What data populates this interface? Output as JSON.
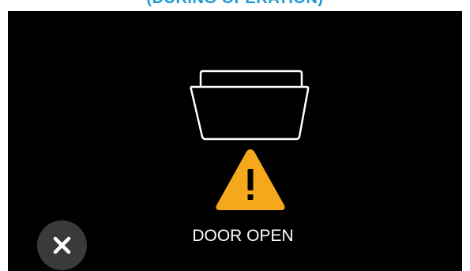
{
  "header": {
    "caption": "(DURING OPERATION)"
  },
  "alert": {
    "message": "DOOR OPEN",
    "icons": {
      "door": "door-open-icon",
      "warning": "warning-triangle-icon",
      "close": "close-icon"
    }
  },
  "colors": {
    "caption": "#1a9bd7",
    "background": "#000000",
    "warning": "#f5a81c",
    "close_button": "#3a3a3a",
    "text": "#ffffff"
  }
}
